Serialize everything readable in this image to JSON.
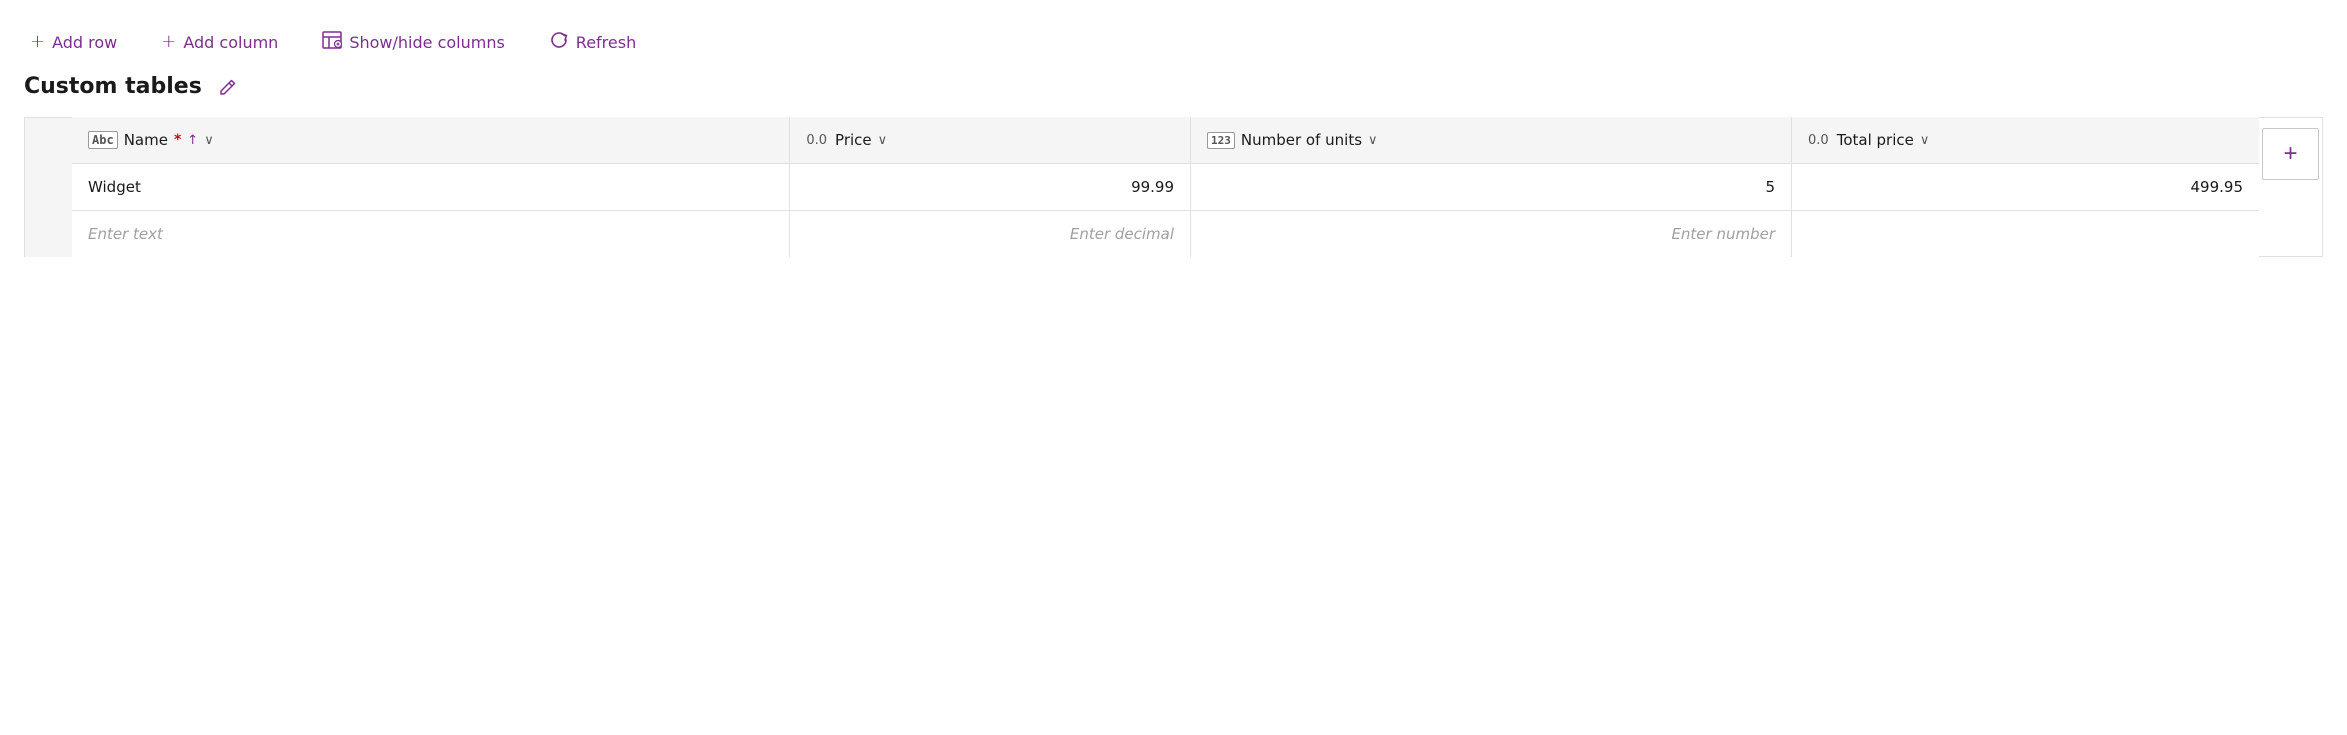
{
  "toolbar": {
    "add_row_label": "Add row",
    "add_column_label": "Add column",
    "show_hide_label": "Show/hide columns",
    "refresh_label": "Refresh"
  },
  "page": {
    "title": "Custom tables",
    "edit_tooltip": "Edit"
  },
  "table": {
    "columns": [
      {
        "id": "name",
        "type_icon": "Abc",
        "icon_style": "abc",
        "label": "Name",
        "required": true,
        "sort": true,
        "dropdown": true,
        "prefix": ""
      },
      {
        "id": "price",
        "type_icon": "0.0",
        "icon_style": "decimal",
        "label": "Price",
        "required": false,
        "sort": false,
        "dropdown": true,
        "prefix": ""
      },
      {
        "id": "units",
        "type_icon": "123",
        "icon_style": "123",
        "label": "Number of units",
        "required": false,
        "sort": false,
        "dropdown": true,
        "prefix": ""
      },
      {
        "id": "total",
        "type_icon": "0.0",
        "icon_style": "decimal",
        "label": "Total price",
        "required": false,
        "sort": false,
        "dropdown": true,
        "prefix": ""
      }
    ],
    "rows": [
      {
        "name": "Widget",
        "price": "99.99",
        "units": "5",
        "total": "499.95"
      }
    ],
    "new_row": {
      "name_placeholder": "Enter text",
      "price_placeholder": "Enter decimal",
      "units_placeholder": "Enter number",
      "total_placeholder": ""
    },
    "add_column_label": "+"
  }
}
